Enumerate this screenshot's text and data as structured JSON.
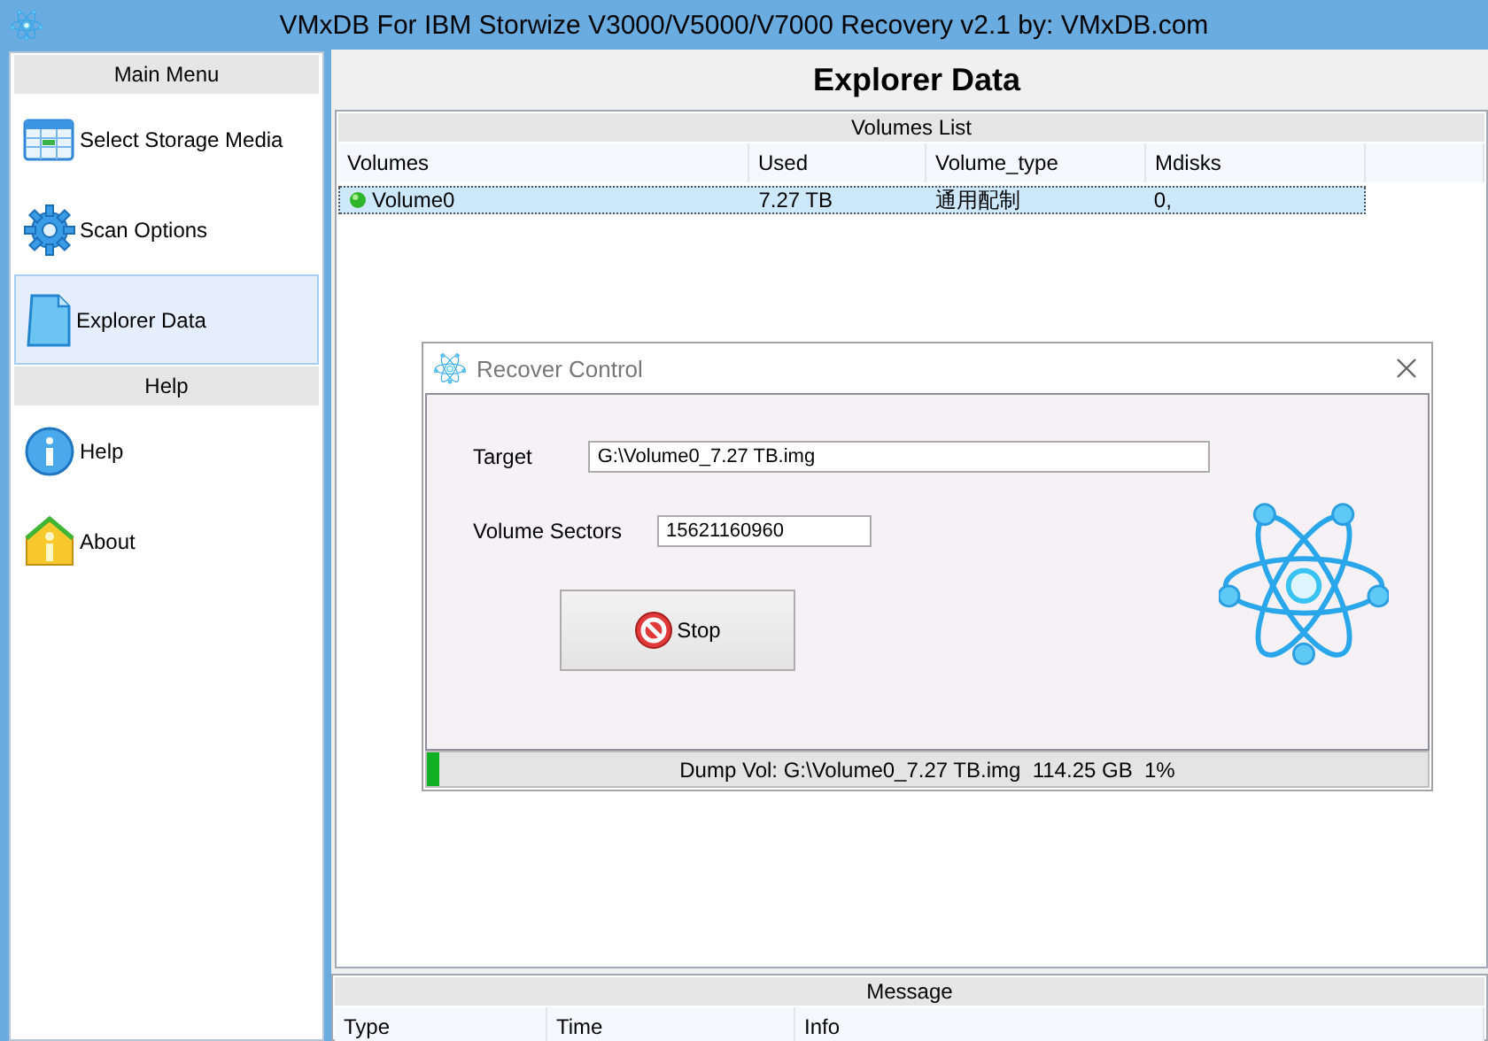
{
  "window": {
    "title": "VMxDB For IBM Storwize V3000/V5000/V7000 Recovery v2.1 by: VMxDB.com"
  },
  "sidebar": {
    "groups": [
      {
        "title": "Main Menu",
        "items": [
          {
            "label": "Select Storage Media",
            "kind": "table",
            "selected": false
          },
          {
            "label": "Scan Options",
            "kind": "gear",
            "selected": false
          },
          {
            "label": "Explorer Data",
            "kind": "document",
            "selected": true
          }
        ]
      },
      {
        "title": "Help",
        "items": [
          {
            "label": "Help",
            "kind": "info",
            "selected": false
          },
          {
            "label": "About",
            "kind": "house",
            "selected": false
          }
        ]
      }
    ]
  },
  "page_title": "Explorer Data",
  "volumes_list": {
    "title": "Volumes List",
    "columns": [
      "Volumes",
      "Used",
      "Volume_type",
      "Mdisks"
    ],
    "rows": [
      {
        "cells": [
          "Volume0",
          "7.27 TB",
          "通用配制",
          "0,"
        ],
        "selected": true
      }
    ]
  },
  "message": {
    "title": "Message",
    "columns": [
      "Type",
      "Time",
      "Info"
    ]
  },
  "dialog": {
    "title": "Recover Control",
    "fields": [
      {
        "label": "Target",
        "value": "G:\\Volume0_7.27 TB.img"
      },
      {
        "label": "Volume Sectors",
        "value": "15621160960"
      }
    ],
    "button": "Stop",
    "status": {
      "text": "Dump Vol: G:\\Volume0_7.27 TB.img  114.25 GB  1%",
      "level": 0.012
    }
  }
}
